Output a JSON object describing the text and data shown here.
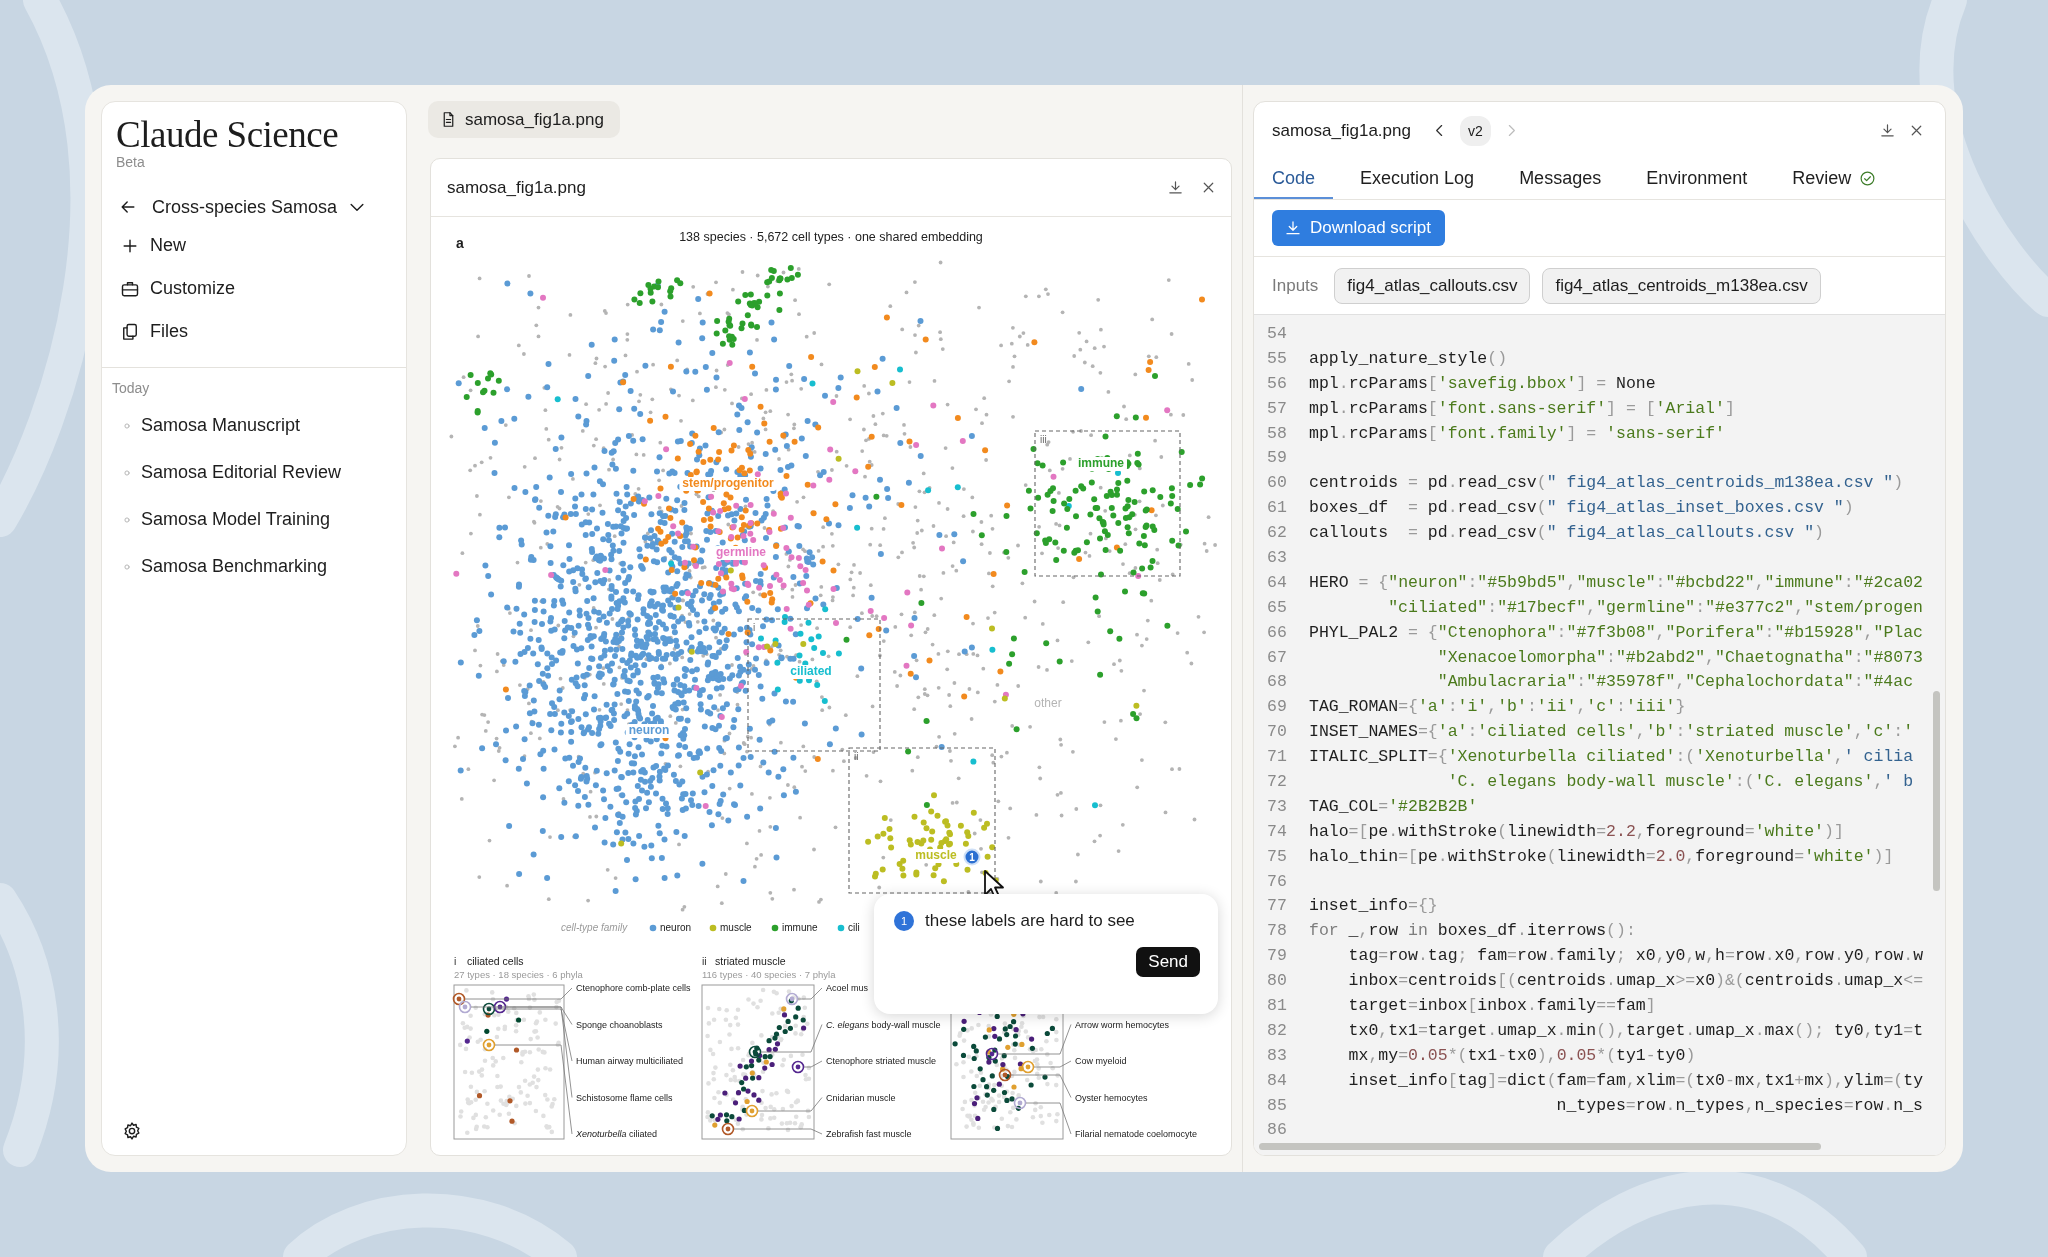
{
  "sidebar": {
    "brand": "Claude Science",
    "badge": "Beta",
    "project": "Cross-species Samosa",
    "actions": [
      "New",
      "Customize",
      "Files"
    ],
    "section": "Today",
    "chats": [
      "Samosa Manuscript",
      "Samosa Editorial Review",
      "Samosa Model Training",
      "Samosa Benchmarking"
    ]
  },
  "file_tab": "samosa_fig1a.png",
  "viewer": {
    "title": "samosa_fig1a.png",
    "figure": {
      "panel_letter": "a",
      "subtitle": "138 species · 5,672 cell types · one shared embedding",
      "clusters": [
        {
          "label": "stem/progenitor",
          "color": "#f28a1e"
        },
        {
          "label": "germline",
          "color": "#e377c2"
        },
        {
          "label": "ciliated",
          "color": "#17becf"
        },
        {
          "label": "neuron",
          "color": "#5b9bd5"
        },
        {
          "label": "immune",
          "color": "#2ca02c"
        },
        {
          "label": "other",
          "color": "#b4b4b4"
        },
        {
          "label": "muscle",
          "color": "#bcbd22"
        }
      ],
      "box_tags": [
        "i",
        "ii",
        "iii"
      ],
      "pin": "1",
      "legend": {
        "title": "cell-type family",
        "items": [
          {
            "label": "neuron",
            "color": "#5b9bd5"
          },
          {
            "label": "muscle",
            "color": "#bcbd22"
          },
          {
            "label": "immune",
            "color": "#2ca02c"
          },
          {
            "label": "cili",
            "color": "#17becf"
          }
        ]
      },
      "insets": [
        {
          "tag": "i",
          "title": "ciliated cells",
          "subtitle": "27 types · 18 species · 6 phyla",
          "callouts": [
            "Ctenophore comb-plate cells",
            "Sponge choanoblasts",
            "Human airway multiciliated",
            "Schistosome flame cells",
            "*Xenoturbella* ciliated"
          ]
        },
        {
          "tag": "ii",
          "title": "striated muscle",
          "subtitle": "116 types · 40 species · 7 phyla",
          "callouts": [
            "Acoel mus",
            "*C. elegans* body-wall muscle",
            "Ctenophore striated muscle",
            "Cnidarian muscle",
            "Zebrafish fast muscle"
          ]
        },
        {
          "callouts": [
            "Arrow worm hemocytes",
            "Cow myeloid",
            "Oyster hemocytes",
            "Filarial nematode coelomocyte"
          ]
        }
      ]
    }
  },
  "comment": {
    "number": "1",
    "text": "these labels are hard to see",
    "button": "Send"
  },
  "panel": {
    "title": "samosa_fig1a.png",
    "version": "v2",
    "next_enabled": false,
    "tabs": [
      {
        "label": "Code",
        "selected": true,
        "verified": false
      },
      {
        "label": "Execution Log",
        "selected": false,
        "verified": false
      },
      {
        "label": "Messages",
        "selected": false,
        "verified": false
      },
      {
        "label": "Environment",
        "selected": false,
        "verified": false
      },
      {
        "label": "Review",
        "selected": false,
        "verified": true
      }
    ],
    "download_button": "Download script",
    "inputs_label": "Inputs",
    "inputs": [
      "fig4_atlas_callouts.csv",
      "fig4_atlas_centroids_m138ea.csv"
    ],
    "code": [
      {
        "number": "54"
      },
      {
        "number": "55",
        "text": "apply_nature_style()"
      },
      {
        "number": "56",
        "text": "mpl.rcParams['savefig.bbox'] = None"
      },
      {
        "number": "57",
        "text": "mpl.rcParams['font.sans-serif'] = ['Arial']"
      },
      {
        "number": "58",
        "text": "mpl.rcParams['font.family'] = 'sans-serif'"
      },
      {
        "number": "59"
      },
      {
        "number": "60",
        "text": "centroids = pd.read_csv(\" fig4_atlas_centroids_m138ea.csv \")"
      },
      {
        "number": "61",
        "text": "boxes_df  = pd.read_csv(\" fig4_atlas_inset_boxes.csv \")"
      },
      {
        "number": "62",
        "text": "callouts  = pd.read_csv(\" fig4_atlas_callouts.csv \")"
      },
      {
        "number": "63"
      },
      {
        "number": "64",
        "text": "HERO = {\"neuron\":\"#5b9bd5\",\"muscle\":\"#bcbd22\",\"immune\":\"#2ca02"
      },
      {
        "number": "65",
        "text": "        \"ciliated\":\"#17becf\",\"germline\":\"#e377c2\",\"stem/progen"
      },
      {
        "number": "66",
        "text": "PHYL_PAL2 = {\"Ctenophora\":\"#7f3b08\",\"Porifera\":\"#b15928\",\"Plac"
      },
      {
        "number": "67",
        "text": "             \"Xenacoelomorpha\":\"#b2abd2\",\"Chaetognatha\":\"#8073"
      },
      {
        "number": "68",
        "text": "             \"Ambulacraria\":\"#35978f\",\"Cephalochordata\":\"#4ac"
      },
      {
        "number": "69",
        "text": "TAG_ROMAN={'a':'i','b':'ii','c':'iii'}"
      },
      {
        "number": "70",
        "text": "INSET_NAMES={'a':'ciliated cells','b':'striated muscle','c':'"
      },
      {
        "number": "71",
        "text": "ITALIC_SPLIT={'Xenoturbella ciliated':('Xenoturbella',' cilia"
      },
      {
        "number": "72",
        "text": "              'C. elegans body-wall muscle':('C. elegans',' b"
      },
      {
        "number": "73",
        "text": "TAG_COL='#2B2B2B'"
      },
      {
        "number": "74",
        "text": "halo=[pe.withStroke(linewidth=2.2,foreground='white')]"
      },
      {
        "number": "75",
        "text": "halo_thin=[pe.withStroke(linewidth=2.0,foreground='white')]"
      },
      {
        "number": "76"
      },
      {
        "number": "77",
        "text": "inset_info={}"
      },
      {
        "number": "78",
        "text": "for _,row in boxes_df.iterrows():"
      },
      {
        "number": "79",
        "text": "    tag=row.tag; fam=row.family; x0,y0,w,h=row.x0,row.y0,row.w"
      },
      {
        "number": "80",
        "text": "    inbox=centroids[(centroids.umap_x>=x0)&(centroids.umap_x<="
      },
      {
        "number": "81",
        "text": "    target=inbox[inbox.family==fam]"
      },
      {
        "number": "82",
        "text": "    tx0,tx1=target.umap_x.min(),target.umap_x.max(); ty0,ty1=t"
      },
      {
        "number": "83",
        "text": "    mx,my=0.05*(tx1-tx0),0.05*(ty1-ty0)"
      },
      {
        "number": "84",
        "text": "    inset_info[tag]=dict(fam=fam,xlim=(tx0-mx,tx1+mx),ylim=(ty"
      },
      {
        "number": "85",
        "text": "                         n_types=row.n_types,n_species=row.n_s"
      },
      {
        "number": "86"
      }
    ]
  }
}
